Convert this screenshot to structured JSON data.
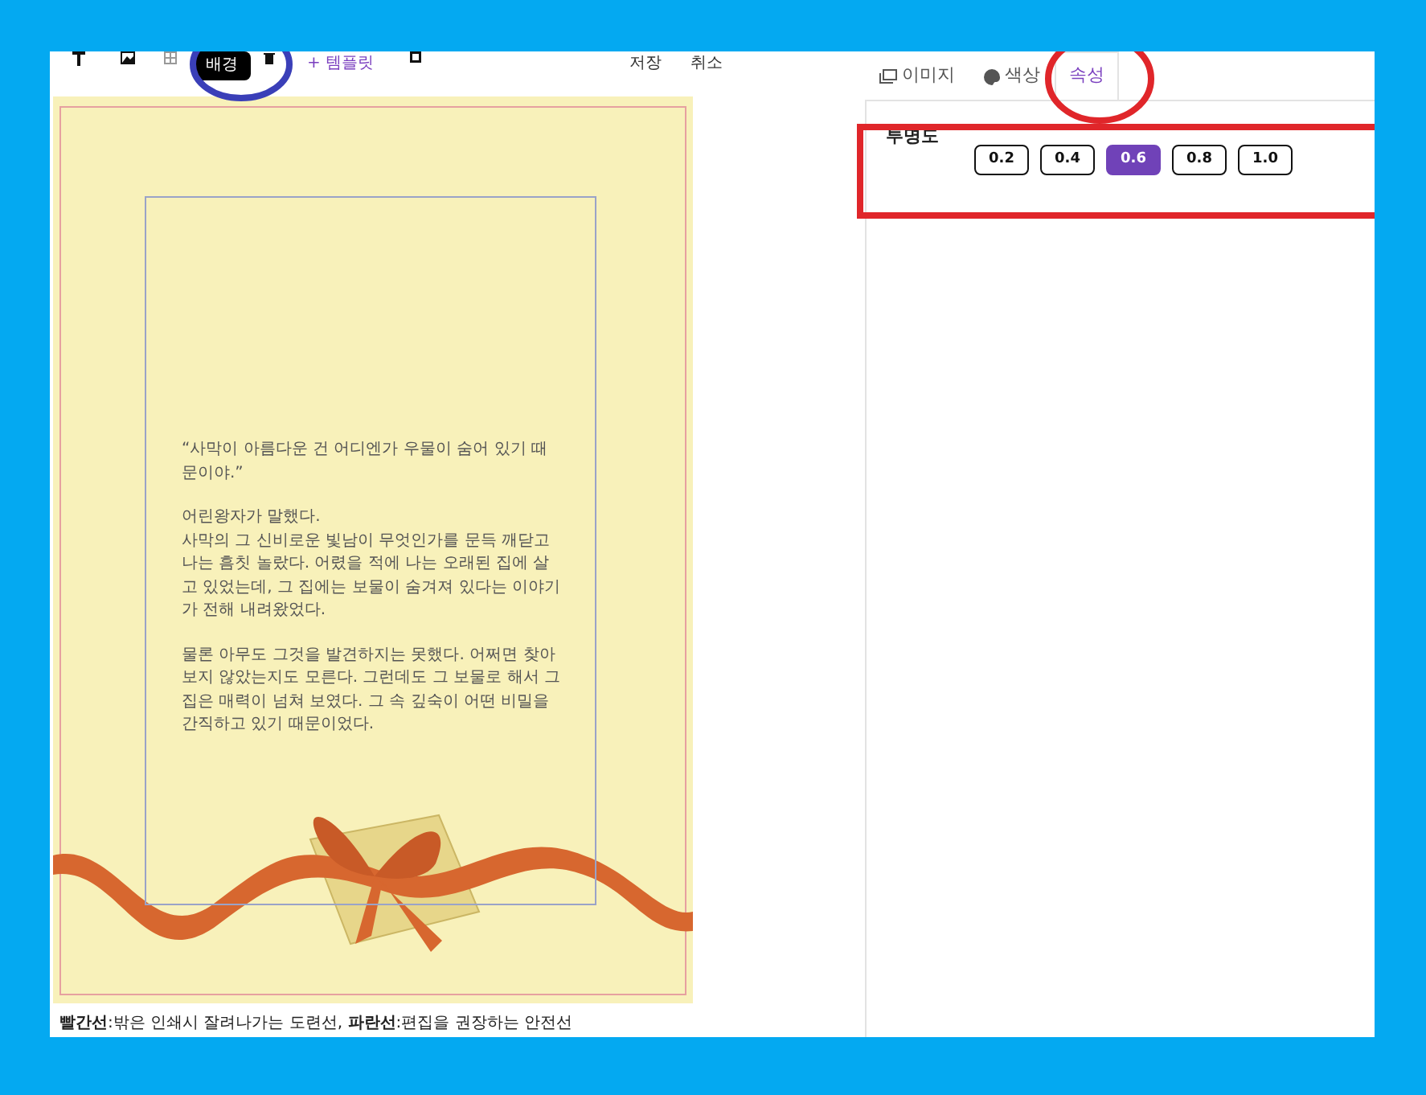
{
  "toolbar": {
    "background_button": {
      "label": "배경",
      "selected": true
    },
    "template_link": "+ 템플릿",
    "save": "저장",
    "cancel": "취소"
  },
  "canvas": {
    "paragraphs": [
      "“사막이 아름다운 건 어디엔가 우물이 숨어 있기 때문이야.”",
      "어린왕자가 말했다.\n사막의 그 신비로운 빛남이 무엇인가를 문득 깨닫고 나는 흠칫 놀랐다. 어렸을 적에 나는 오래된 집에 살고 있었는데, 그 집에는 보물이 숨겨져 있다는 이야기가 전해 내려왔었다.",
      "물론 아무도 그것을 발견하지는 못했다. 어쩌면 찾아보지 않았는지도 모른다. 그런데도 그 보물로 해서 그 집은 매력이 넘쳐 보였다. 그 속 깊숙이 어떤 비밀을 간직하고 있기 때문이었다."
    ]
  },
  "legend": "**빨간선**:밖은 인쇄시 잘려나가는 도련선, **파란선**:편집을 권장하는 안전선",
  "tabs": [
    {
      "label": "이미지",
      "selected": false
    },
    {
      "label": "색상",
      "selected": false
    },
    {
      "label": "속성",
      "selected": true
    }
  ],
  "opacity": {
    "label": "투명도",
    "options": [
      {
        "label": "0.2",
        "selected": false
      },
      {
        "label": "0.4",
        "selected": false
      },
      {
        "label": "0.6",
        "selected": true
      },
      {
        "label": "0.8",
        "selected": false
      },
      {
        "label": "1.0",
        "selected": false
      }
    ]
  }
}
